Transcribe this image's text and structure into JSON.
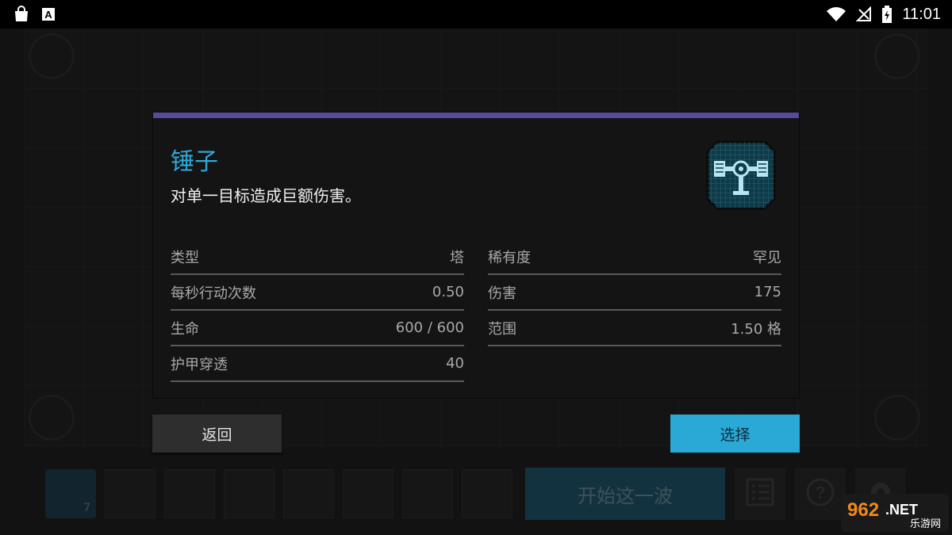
{
  "status_bar": {
    "time": "11:01",
    "icons": [
      "shopping-bag-icon",
      "text-a-icon",
      "wifi-icon",
      "no-signal-icon",
      "battery-charging-icon"
    ]
  },
  "dialog": {
    "accent_color": "#5a4a9c",
    "title": "锤子",
    "description": "对单一目标造成巨额伤害。",
    "icon": "hammer-tower-icon",
    "stats_left": [
      {
        "label": "类型",
        "value": "塔"
      },
      {
        "label": "每秒行动次数",
        "value": "0.50"
      },
      {
        "label": "生命",
        "value": "600 / 600"
      },
      {
        "label": "护甲穿透",
        "value": "40"
      }
    ],
    "stats_right": [
      {
        "label": "稀有度",
        "value": "罕见"
      },
      {
        "label": "伤害",
        "value": "175"
      },
      {
        "label": "范围",
        "value": "1.50 格"
      }
    ]
  },
  "buttons": {
    "back": "返回",
    "select": "选择",
    "select_color": "#2aa9d6"
  },
  "bottom_bar": {
    "first_slot_count": "7",
    "start_wave": "开始这一波",
    "icons": [
      "list-icon",
      "help-icon",
      "settings-icon"
    ]
  },
  "watermark": {
    "logo_text": "962.NET",
    "sub_text": "乐游网"
  }
}
